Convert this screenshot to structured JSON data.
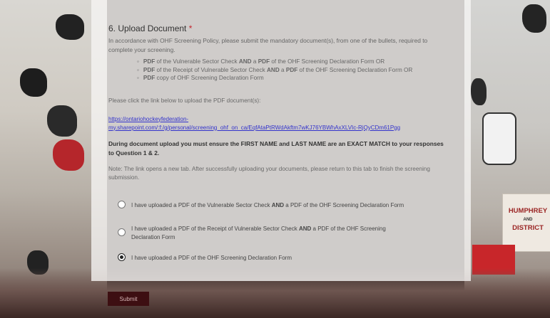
{
  "question": {
    "number_title": "6. Upload Document",
    "required_marker": "*",
    "intro": "In accordance with OHF Screening Policy, please submit the mandatory document(s), from one of the bullets, required to      complete your screening.",
    "bullets": [
      {
        "a_bold": "PDF",
        "a": " of the Vulnerable Sector Check ",
        "b_bold": "AND",
        "b": " a ",
        "c_bold": "PDF",
        "c": " of the OHF Screening Declaration Form OR"
      },
      {
        "a_bold": "PDF",
        "a": " of the Receipt of Vulnerable Sector Check ",
        "b_bold": "AND",
        "b": " a ",
        "c_bold": "PDF",
        "c": " of the OHF Screening Declaration Form OR"
      },
      {
        "a_bold": "PDF",
        "a": " copy of OHF Screening Declaration Form",
        "b_bold": "",
        "b": "",
        "c_bold": "",
        "c": ""
      }
    ],
    "click_link_text": "Please click the link below to upload the PDF document(s):",
    "upload_link_line1": "https://ontariohockeyfederation-",
    "upload_link_line2": "my.sharepoint.com/:f:/g/personal/screening_ohf_on_ca/EqfAtaPtRWdAkftm7wKJ76YBWhAxXLVIc-RjQyCDm61Pgg",
    "match_note": "During document upload you must ensure the FIRST NAME and LAST NAME are an EXACT MATCH to your responses to Question 1 & 2.",
    "tab_note": "Note: The link opens a new tab. After successfully uploading your documents, please return to this tab to finish the screening submission."
  },
  "options": [
    {
      "pre": "I have uploaded a PDF of the Vulnerable Sector Check ",
      "bold": "AND",
      "post": " a PDF of the OHF Screening Declaration Form",
      "checked": false
    },
    {
      "pre": "I have uploaded a PDF of the Receipt of Vulnerable Sector Check ",
      "bold": "AND",
      "post": " a PDF of the OHF Screening Declaration Form",
      "checked": false
    },
    {
      "pre": "I have uploaded a PDF of the OHF Screening Declaration Form",
      "bold": "",
      "post": "",
      "checked": true
    }
  ],
  "submit_label": "Submit",
  "background": {
    "banner_line1": "HUMPHREY",
    "banner_line2": "AND",
    "banner_line3": "DISTRICT"
  },
  "colors": {
    "required": "#c4262e",
    "link": "#3333cc",
    "submit_bg": "#3d0f12"
  }
}
